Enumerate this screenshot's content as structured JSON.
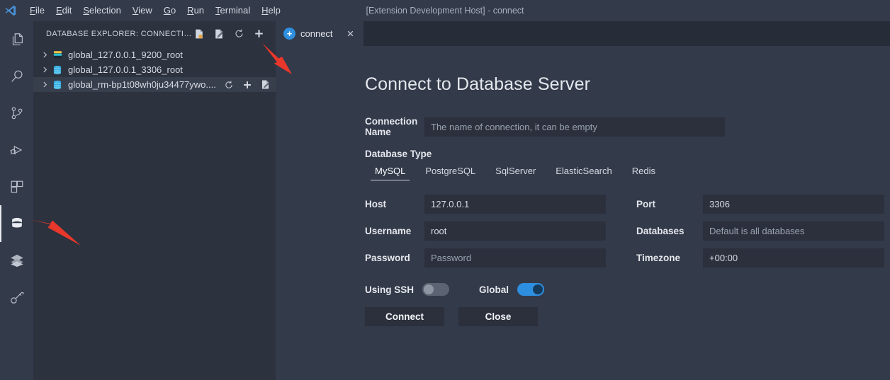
{
  "titlebar": {
    "window_title": "[Extension Development Host] - connect",
    "logo_icon": "vscode-logo-icon",
    "menus": [
      {
        "label": "File",
        "mnemonic": "F"
      },
      {
        "label": "Edit",
        "mnemonic": "E"
      },
      {
        "label": "Selection",
        "mnemonic": "S"
      },
      {
        "label": "View",
        "mnemonic": "V"
      },
      {
        "label": "Go",
        "mnemonic": "G"
      },
      {
        "label": "Run",
        "mnemonic": "R"
      },
      {
        "label": "Terminal",
        "mnemonic": "T"
      },
      {
        "label": "Help",
        "mnemonic": "H"
      }
    ]
  },
  "activitybar": {
    "items": [
      {
        "name": "explorer",
        "icon": "files-icon",
        "active": false
      },
      {
        "name": "search",
        "icon": "search-icon",
        "active": false
      },
      {
        "name": "source-control",
        "icon": "source-control-icon",
        "active": false
      },
      {
        "name": "run-and-debug",
        "icon": "run-debug-icon",
        "active": false
      },
      {
        "name": "extensions",
        "icon": "extensions-icon",
        "active": false
      },
      {
        "name": "database",
        "icon": "database-icon",
        "active": true
      },
      {
        "name": "layers",
        "icon": "layers-icon",
        "active": false
      },
      {
        "name": "key",
        "icon": "key-icon",
        "active": false
      }
    ]
  },
  "sidebar": {
    "title": "DATABASE EXPLORER: CONNECTIO...",
    "actions": [
      {
        "name": "new-query-file",
        "icon": "sql-file-icon"
      },
      {
        "name": "edit-file",
        "icon": "edit-file-icon"
      },
      {
        "name": "refresh",
        "icon": "refresh-icon"
      },
      {
        "name": "add-connection",
        "icon": "plus-icon"
      }
    ],
    "tree": [
      {
        "label": "global_127.0.0.1_9200_root",
        "icon": "elasticsearch-icon",
        "expanded": false,
        "selected": false,
        "actions": []
      },
      {
        "label": "global_127.0.0.1_3306_root",
        "icon": "mysql-database-icon",
        "expanded": false,
        "selected": false,
        "actions": []
      },
      {
        "label": "global_rm-bp1t08wh0ju34477ywo....",
        "icon": "mysql-database-icon",
        "expanded": false,
        "selected": true,
        "actions": [
          {
            "name": "refresh-connection",
            "icon": "refresh-icon"
          },
          {
            "name": "add-to-connection",
            "icon": "plus-icon"
          },
          {
            "name": "edit-connection",
            "icon": "edit-file-icon"
          }
        ]
      }
    ]
  },
  "editor": {
    "tabs": [
      {
        "label": "connect",
        "icon": "plus-circle-icon",
        "active": true,
        "close_icon": "close-icon"
      }
    ]
  },
  "form": {
    "title": "Connect to Database Server",
    "connection_name": {
      "label": "Connection Name",
      "value": "",
      "placeholder": "The name of connection, it can be empty"
    },
    "database_type": {
      "label": "Database Type",
      "options": [
        "MySQL",
        "PostgreSQL",
        "SqlServer",
        "ElasticSearch",
        "Redis"
      ],
      "selected": "MySQL"
    },
    "fields_left": [
      {
        "name": "host",
        "label": "Host",
        "value": "127.0.0.1",
        "placeholder": ""
      },
      {
        "name": "username",
        "label": "Username",
        "value": "root",
        "placeholder": ""
      },
      {
        "name": "password",
        "label": "Password",
        "value": "",
        "placeholder": "Password"
      }
    ],
    "fields_right": [
      {
        "name": "port",
        "label": "Port",
        "value": "3306",
        "placeholder": ""
      },
      {
        "name": "databases",
        "label": "Databases",
        "value": "",
        "placeholder": "Default is all databases"
      },
      {
        "name": "timezone",
        "label": "Timezone",
        "value": "+00:00",
        "placeholder": ""
      }
    ],
    "toggles": [
      {
        "name": "using-ssh",
        "label": "Using SSH",
        "on": false
      },
      {
        "name": "global",
        "label": "Global",
        "on": true
      }
    ],
    "buttons": [
      {
        "name": "connect",
        "label": "Connect"
      },
      {
        "name": "close",
        "label": "Close"
      }
    ]
  },
  "annotations": {
    "arrow_color": "#e8372b",
    "arrows": [
      {
        "name": "arrow-pointing-to-add-connection"
      },
      {
        "name": "arrow-pointing-to-database-activity-icon"
      }
    ]
  },
  "colors": {
    "accent": "#2e8fe0",
    "activitybar_bg": "#333a4a",
    "sidebar_bg": "#2c323e",
    "editor_bg": "#333a4a",
    "tabbar_bg": "#262c38",
    "input_bg": "#2b303c"
  }
}
